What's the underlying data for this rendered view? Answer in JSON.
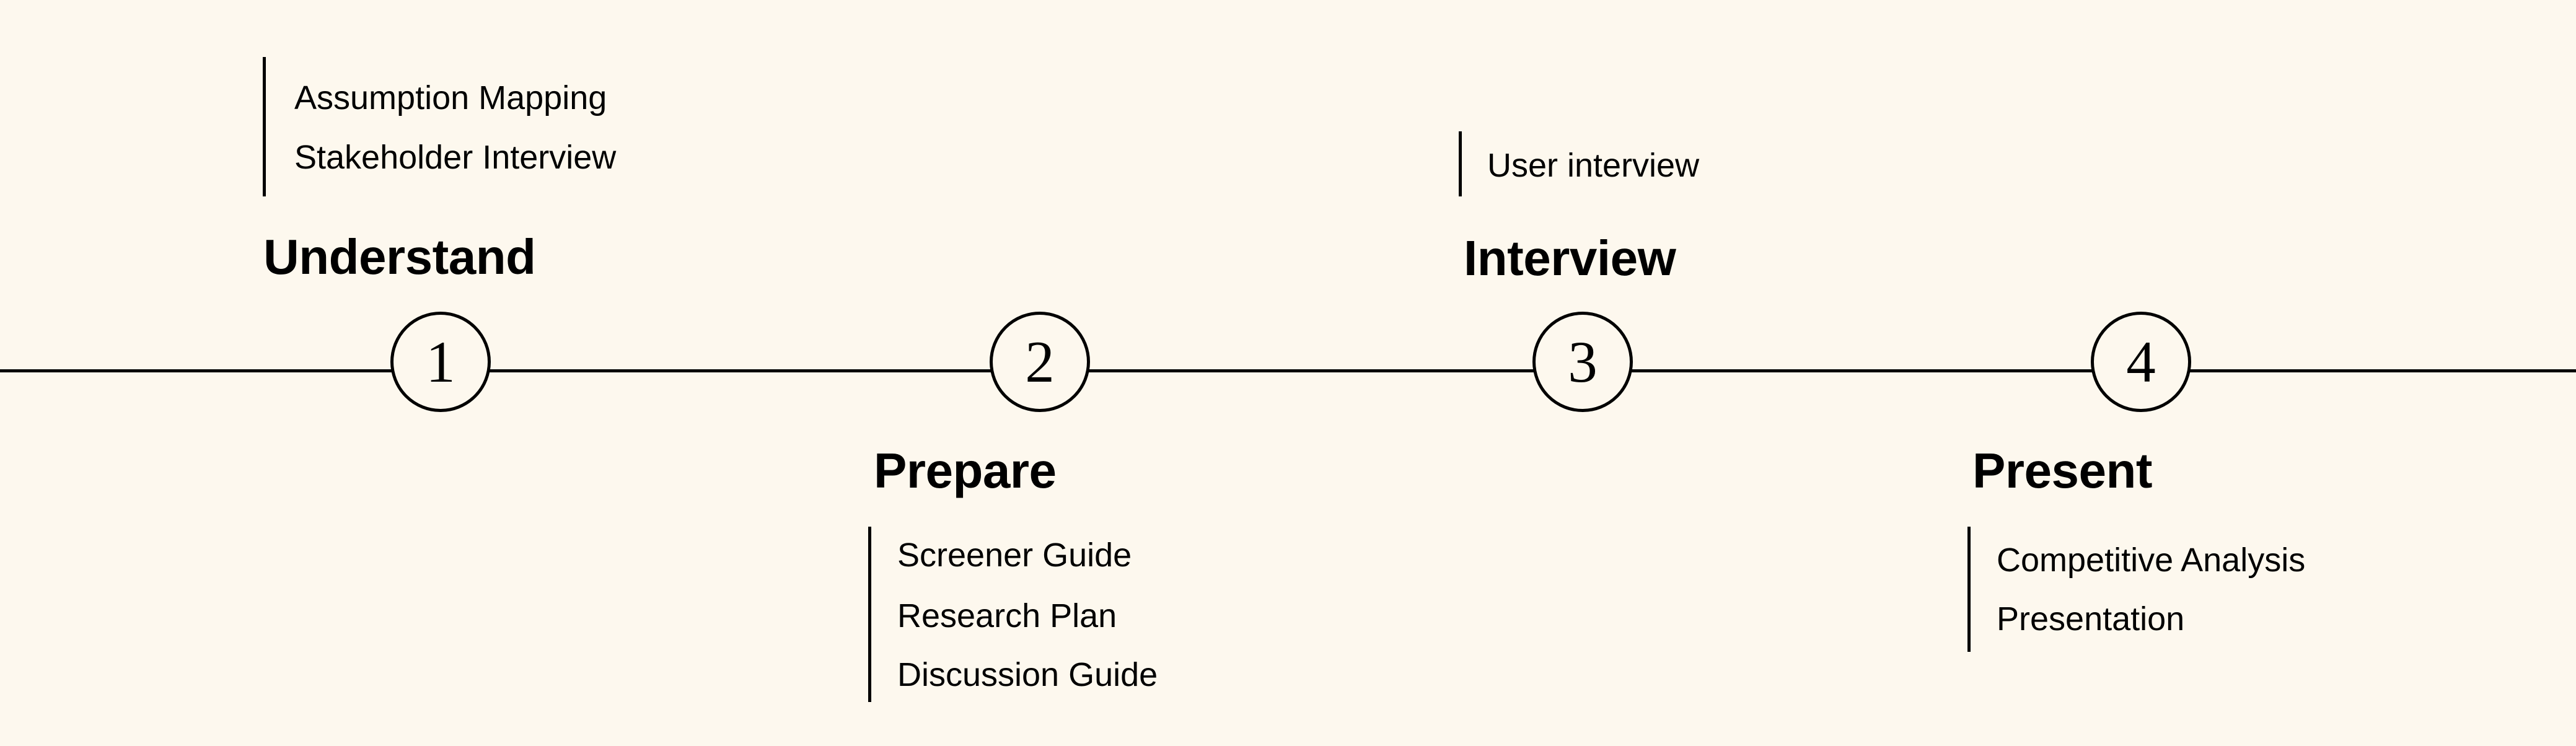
{
  "colors": {
    "background": "#fdf8ee",
    "ink": "#000000"
  },
  "steps": [
    {
      "number": "1",
      "heading": "Understand",
      "items": [
        "Assumption Mapping",
        "Stakeholder Interview"
      ]
    },
    {
      "number": "2",
      "heading": "Prepare",
      "items": [
        "Screener Guide",
        "Research Plan",
        "Discussion Guide"
      ]
    },
    {
      "number": "3",
      "heading": "Interview",
      "items": [
        "User interview"
      ]
    },
    {
      "number": "4",
      "heading": "Present",
      "items": [
        "Competitive Analysis",
        "Presentation"
      ]
    }
  ]
}
